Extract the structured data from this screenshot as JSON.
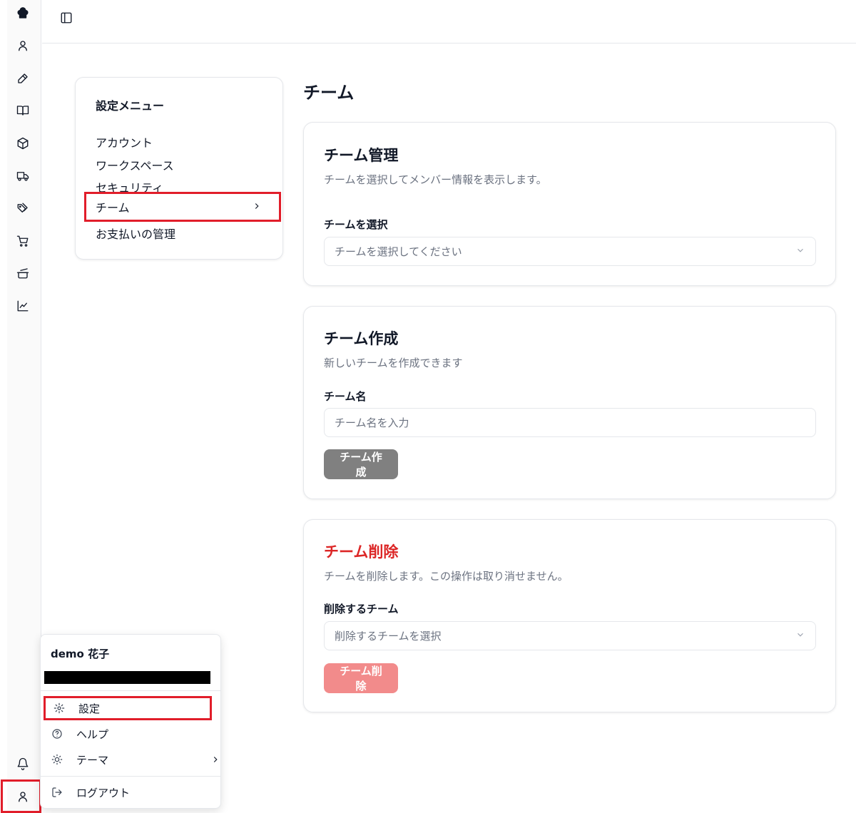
{
  "settings_menu": {
    "title": "設定メニュー",
    "items": [
      "アカウント",
      "ワークスペース",
      "セキュリティ",
      "チーム",
      "お支払いの管理"
    ]
  },
  "page": {
    "title": "チーム"
  },
  "team_manage": {
    "title": "チーム管理",
    "description": "チームを選択してメンバー情報を表示します。",
    "select_label": "チームを選択",
    "select_placeholder": "チームを選択してください"
  },
  "team_create": {
    "title": "チーム作成",
    "description": "新しいチームを作成できます",
    "name_label": "チーム名",
    "name_placeholder": "チーム名を入力",
    "button": "チーム作成"
  },
  "team_delete": {
    "title": "チーム削除",
    "description": "チームを削除します。この操作は取り消せません。",
    "select_label": "削除するチーム",
    "select_placeholder": "削除するチームを選択",
    "button": "チーム削除"
  },
  "user_menu": {
    "name": "demo 花子",
    "items": [
      "設定",
      "ヘルプ",
      "テーマ",
      "ログアウト"
    ]
  },
  "colors": {
    "highlight": "#e11d2a",
    "danger": "#dc2626",
    "danger_button": "#f28b8b",
    "disabled_button": "#808080"
  },
  "icons": [
    "chef-hat-icon",
    "user-icon",
    "pen-icon",
    "book-icon",
    "box-icon",
    "truck-icon",
    "tags-icon",
    "cart-icon",
    "cooking-pot-icon",
    "chart-line-icon",
    "bell-icon",
    "user-icon"
  ]
}
